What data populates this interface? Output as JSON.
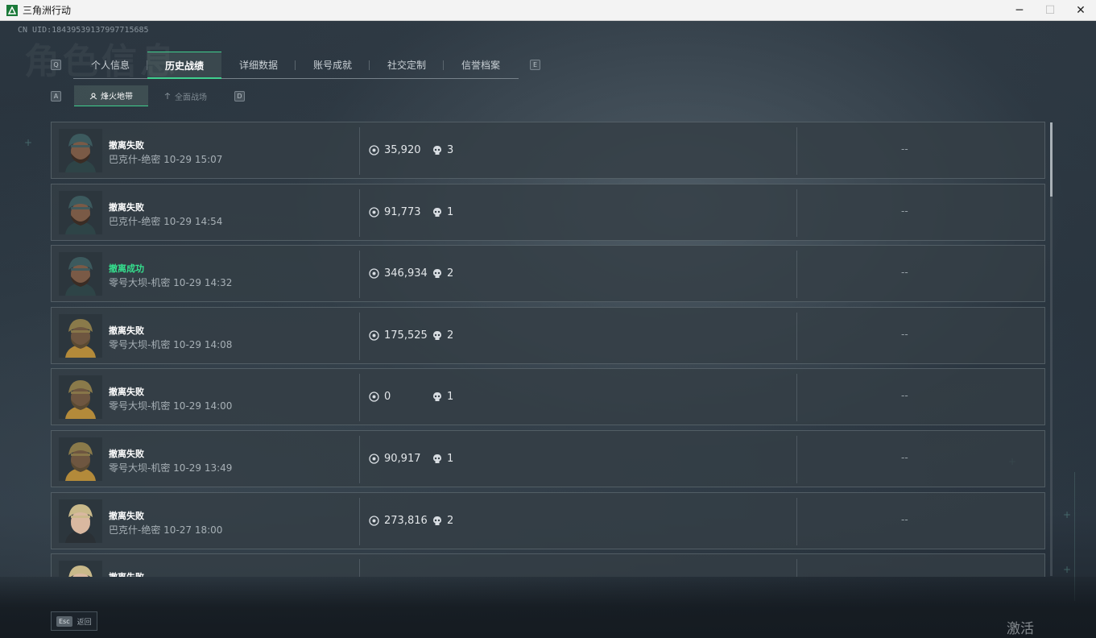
{
  "window": {
    "title": "三角洲行动",
    "minimize": "─",
    "maximize": "☐",
    "close": "✕"
  },
  "header": {
    "uid": "CN UID:18439539137997715685",
    "watermark": "角色信息"
  },
  "tabs": {
    "left_key": "Q",
    "right_key": "E",
    "items": [
      {
        "label": "个人信息"
      },
      {
        "label": "历史战绩",
        "active": true
      },
      {
        "label": "详细数据"
      },
      {
        "label": "账号成就"
      },
      {
        "label": "社交定制"
      },
      {
        "label": "信誉档案"
      }
    ]
  },
  "subtabs": {
    "left_key": "A",
    "right_key": "D",
    "items": [
      {
        "label": "烽火地带",
        "active": true,
        "icon": "beacon-icon"
      },
      {
        "label": "全面战场",
        "active": false,
        "icon": "battlefield-icon"
      }
    ]
  },
  "records": [
    {
      "result": "撤离失败",
      "success": false,
      "map": "巴克什-绝密",
      "time": "10-29 15:07",
      "value": "35,920",
      "kills": "3",
      "extra": "--",
      "avatar": "soldier-cap"
    },
    {
      "result": "撤离失败",
      "success": false,
      "map": "巴克什-绝密",
      "time": "10-29 14:54",
      "value": "91,773",
      "kills": "1",
      "extra": "--",
      "avatar": "soldier-cap"
    },
    {
      "result": "撤离成功",
      "success": true,
      "map": "零号大坝-机密",
      "time": "10-29 14:32",
      "value": "346,934",
      "kills": "2",
      "extra": "--",
      "avatar": "soldier-cap"
    },
    {
      "result": "撤离失败",
      "success": false,
      "map": "零号大坝-机密",
      "time": "10-29 14:08",
      "value": "175,525",
      "kills": "2",
      "extra": "--",
      "avatar": "soldier-camo"
    },
    {
      "result": "撤离失败",
      "success": false,
      "map": "零号大坝-机密",
      "time": "10-29 14:00",
      "value": "0",
      "kills": "1",
      "extra": "--",
      "avatar": "soldier-camo"
    },
    {
      "result": "撤离失败",
      "success": false,
      "map": "零号大坝-机密",
      "time": "10-29 13:49",
      "value": "90,917",
      "kills": "1",
      "extra": "--",
      "avatar": "soldier-camo"
    },
    {
      "result": "撤离失败",
      "success": false,
      "map": "巴克什-绝密",
      "time": "10-27 18:00",
      "value": "273,816",
      "kills": "2",
      "extra": "--",
      "avatar": "soldier-blonde"
    },
    {
      "result": "撤离失败",
      "success": false,
      "map": "",
      "time": "",
      "value": "",
      "kills": "",
      "extra": "",
      "avatar": "soldier-blonde"
    }
  ],
  "footer": {
    "esc_key": "Esc",
    "esc_label": "返回",
    "activation_text": "激活 Windows"
  },
  "colors": {
    "accent": "#3fcf8e",
    "success": "#35e08e",
    "row_bg": "#343e46"
  }
}
